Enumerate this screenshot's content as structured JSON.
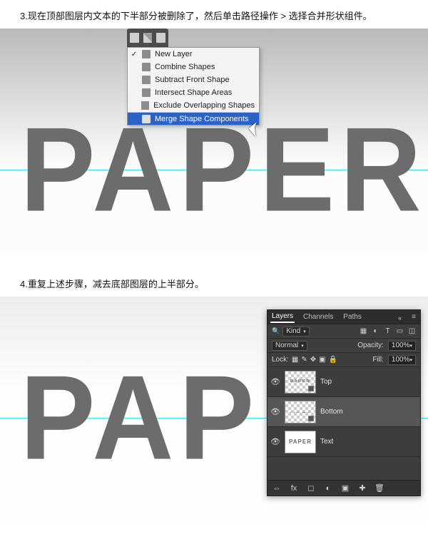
{
  "steps": {
    "s3": "3.现在顶部图层内文本的下半部分被删除了，然后单击路径操作 > 选择合并形状组件。",
    "s4": "4.重复上述步骤，减去底部图层的上半部分。"
  },
  "artwork": {
    "text": "PAPER"
  },
  "toolbar_icons": [
    "path-mode-icon",
    "align-icon",
    "arrange-icon"
  ],
  "menu": {
    "items": [
      {
        "label": "New Layer",
        "checked": true
      },
      {
        "label": "Combine Shapes"
      },
      {
        "label": "Subtract Front Shape"
      },
      {
        "label": "Intersect Shape Areas"
      },
      {
        "label": "Exclude Overlapping Shapes"
      },
      {
        "label": "Merge Shape Components",
        "selected": true,
        "separator": true
      }
    ]
  },
  "panel": {
    "tabs": [
      "Layers",
      "Channels",
      "Paths"
    ],
    "active_tab": 0,
    "kind_label": "Kind",
    "filter_icons": [
      "image-icon",
      "adjust-icon",
      "type-icon",
      "shape-icon",
      "smart-icon"
    ],
    "blend_mode": "Normal",
    "opacity_label": "Opacity:",
    "opacity_value": "100%",
    "lock_label": "Lock:",
    "lock_icons": [
      "image-lock-icon",
      "brush-lock-icon",
      "move-lock-icon",
      "artboard-lock-icon",
      "all-lock-icon"
    ],
    "fill_label": "Fill:",
    "fill_value": "100%",
    "layers": [
      {
        "name": "Top",
        "variant": "top",
        "visible": true
      },
      {
        "name": "Bottom",
        "variant": "bot",
        "visible": true,
        "active": true
      },
      {
        "name": "Text",
        "variant": "full",
        "visible": true
      }
    ],
    "footer_icons": [
      "link-icon",
      "fx-icon",
      "mask-icon",
      "adjust-new-icon",
      "group-icon",
      "new-layer-icon",
      "trash-icon"
    ]
  }
}
